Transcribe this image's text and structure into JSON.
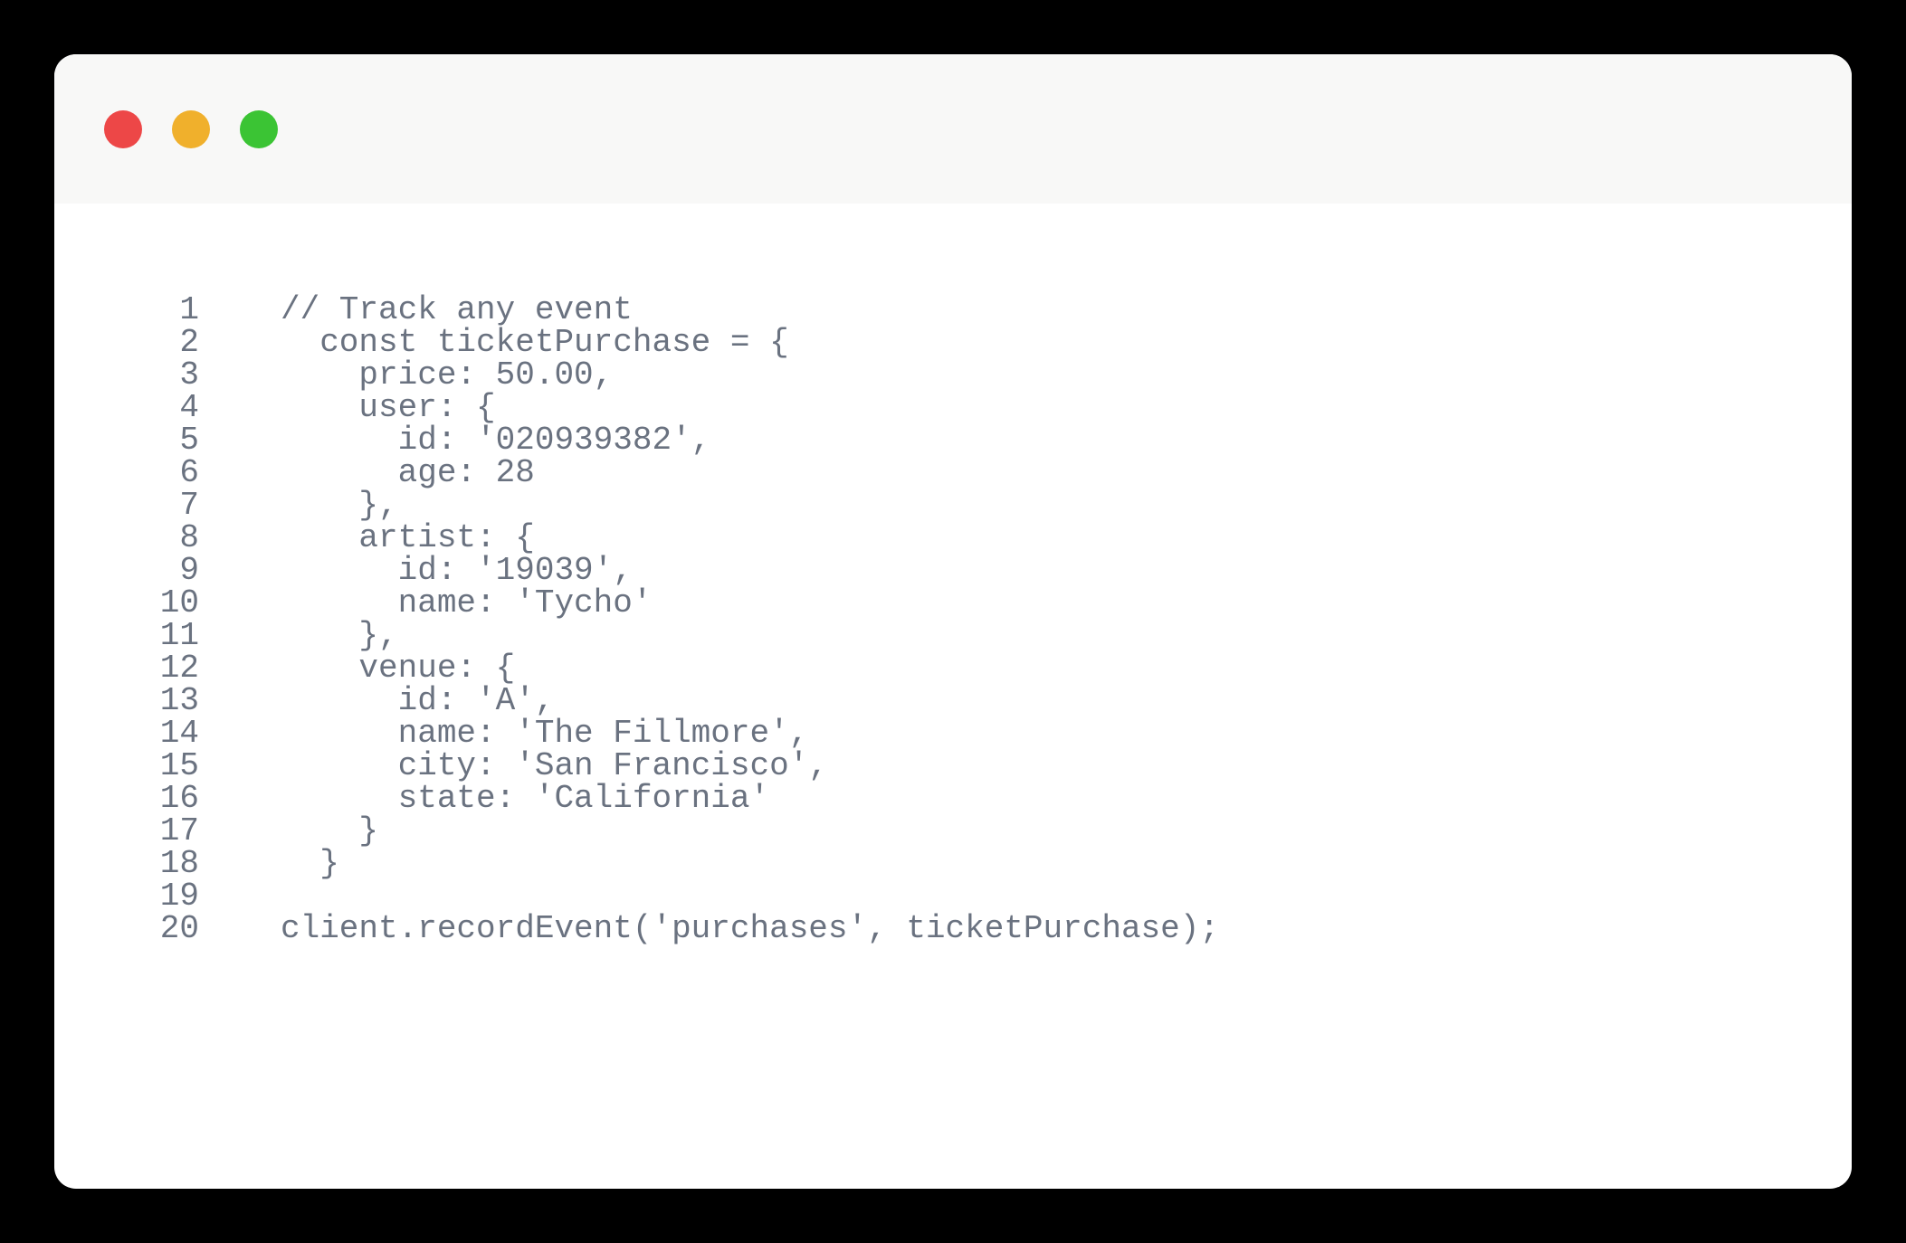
{
  "window": {
    "traffic_lights": {
      "red": "#ed4747",
      "yellow": "#f0b02c",
      "green": "#3bc434"
    }
  },
  "code": {
    "lines": [
      {
        "num": "1",
        "text": "// Track any event"
      },
      {
        "num": "2",
        "text": "  const ticketPurchase = {"
      },
      {
        "num": "3",
        "text": "    price: 50.00,"
      },
      {
        "num": "4",
        "text": "    user: {"
      },
      {
        "num": "5",
        "text": "      id: '020939382',"
      },
      {
        "num": "6",
        "text": "      age: 28"
      },
      {
        "num": "7",
        "text": "    },"
      },
      {
        "num": "8",
        "text": "    artist: {"
      },
      {
        "num": "9",
        "text": "      id: '19039',"
      },
      {
        "num": "10",
        "text": "      name: 'Tycho'"
      },
      {
        "num": "11",
        "text": "    },"
      },
      {
        "num": "12",
        "text": "    venue: {"
      },
      {
        "num": "13",
        "text": "      id: 'A',"
      },
      {
        "num": "14",
        "text": "      name: 'The Fillmore',"
      },
      {
        "num": "15",
        "text": "      city: 'San Francisco',"
      },
      {
        "num": "16",
        "text": "      state: 'California'"
      },
      {
        "num": "17",
        "text": "    }"
      },
      {
        "num": "18",
        "text": "  }"
      },
      {
        "num": "19",
        "text": ""
      },
      {
        "num": "20",
        "text": "client.recordEvent('purchases', ticketPurchase);"
      }
    ]
  }
}
